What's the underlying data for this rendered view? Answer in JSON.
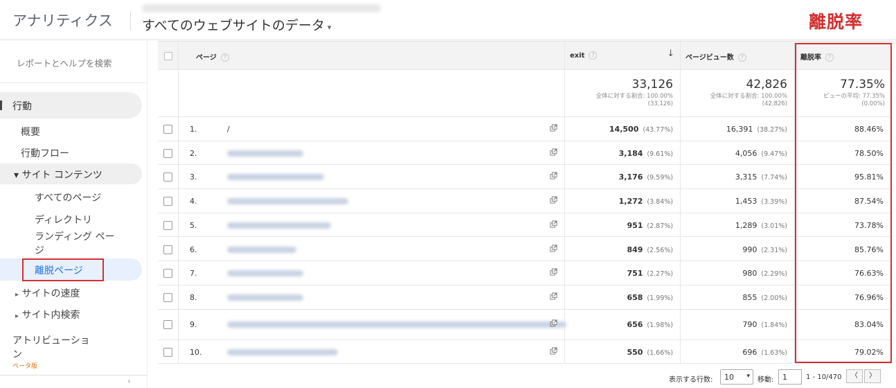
{
  "header": {
    "app_name": "アナリティクス",
    "property": "すべてのウェブサイトのデータ",
    "property_caret": "▾",
    "annotation_title": "離脱率"
  },
  "sidebar": {
    "search_label": "レポートとヘルプを検索",
    "behavior": "行動",
    "overview": "概要",
    "behavior_flow": "行動フロー",
    "site_content": "サイト コンテンツ",
    "all_pages": "すべてのページ",
    "directory": "ディレクトリ",
    "landing_pages": "ランディング ペー\nジ",
    "exit_pages": "離脱ページ",
    "site_speed": "サイトの速度",
    "site_search": "サイト内検索",
    "attribution": "アトリビューショ\nン",
    "beta": "ベータ版",
    "expand_glyph": "▾",
    "collapsed_glyph": "▸",
    "collapse_glyph": "‹"
  },
  "table": {
    "headers": {
      "page": "ページ",
      "exit": "exit",
      "pageviews": "ページビュー数",
      "bounce": "離脱率",
      "help_glyph": "?",
      "sort_glyph": "↓"
    },
    "summary": {
      "exit_total": "33,126",
      "exit_sub1": "全体に対する割合: 100.00%",
      "exit_sub2": "(33,126)",
      "pv_total": "42,826",
      "pv_sub1": "全体に対する割合: 100.00%",
      "pv_sub2": "(42,826)",
      "br_total": "77.35%",
      "br_sub1": "ビューの平均: 77.35%",
      "br_sub2": "(0.00%)"
    },
    "rows": [
      {
        "idx": "1.",
        "path": "/",
        "exit": "14,500",
        "exit_pct": "(43.77%)",
        "pv": "16,391",
        "pv_pct": "(38.27%)",
        "rate": "88.46%"
      },
      {
        "idx": "2.",
        "path": "",
        "exit": "3,184",
        "exit_pct": "(9.61%)",
        "pv": "4,056",
        "pv_pct": "(9.47%)",
        "rate": "78.50%"
      },
      {
        "idx": "3.",
        "path": "",
        "exit": "3,176",
        "exit_pct": "(9.59%)",
        "pv": "3,315",
        "pv_pct": "(7.74%)",
        "rate": "95.81%"
      },
      {
        "idx": "4.",
        "path": "",
        "exit": "1,272",
        "exit_pct": "(3.84%)",
        "pv": "1,453",
        "pv_pct": "(3.39%)",
        "rate": "87.54%"
      },
      {
        "idx": "5.",
        "path": "",
        "exit": "951",
        "exit_pct": "(2.87%)",
        "pv": "1,289",
        "pv_pct": "(3.01%)",
        "rate": "73.78%"
      },
      {
        "idx": "6.",
        "path": "",
        "exit": "849",
        "exit_pct": "(2.56%)",
        "pv": "990",
        "pv_pct": "(2.31%)",
        "rate": "85.76%"
      },
      {
        "idx": "7.",
        "path": "",
        "exit": "751",
        "exit_pct": "(2.27%)",
        "pv": "980",
        "pv_pct": "(2.29%)",
        "rate": "76.63%"
      },
      {
        "idx": "8.",
        "path": "",
        "exit": "658",
        "exit_pct": "(1.99%)",
        "pv": "855",
        "pv_pct": "(2.00%)",
        "rate": "76.96%"
      },
      {
        "idx": "9.",
        "path": "",
        "exit": "656",
        "exit_pct": "(1.98%)",
        "pv": "790",
        "pv_pct": "(1.84%)",
        "rate": "83.04%"
      },
      {
        "idx": "10.",
        "path": "",
        "exit": "550",
        "exit_pct": "(1.66%)",
        "pv": "696",
        "pv_pct": "(1.63%)",
        "rate": "79.02%"
      }
    ]
  },
  "footer": {
    "rows_label": "表示する行数:",
    "rows_value": "10",
    "goto_label": "移動:",
    "goto_value": "1",
    "range": "1 - 10/470",
    "prev": "〈",
    "next": "〉"
  },
  "colors": {
    "accent_red": "#d32f2f",
    "link_blue": "#1a73e8"
  }
}
